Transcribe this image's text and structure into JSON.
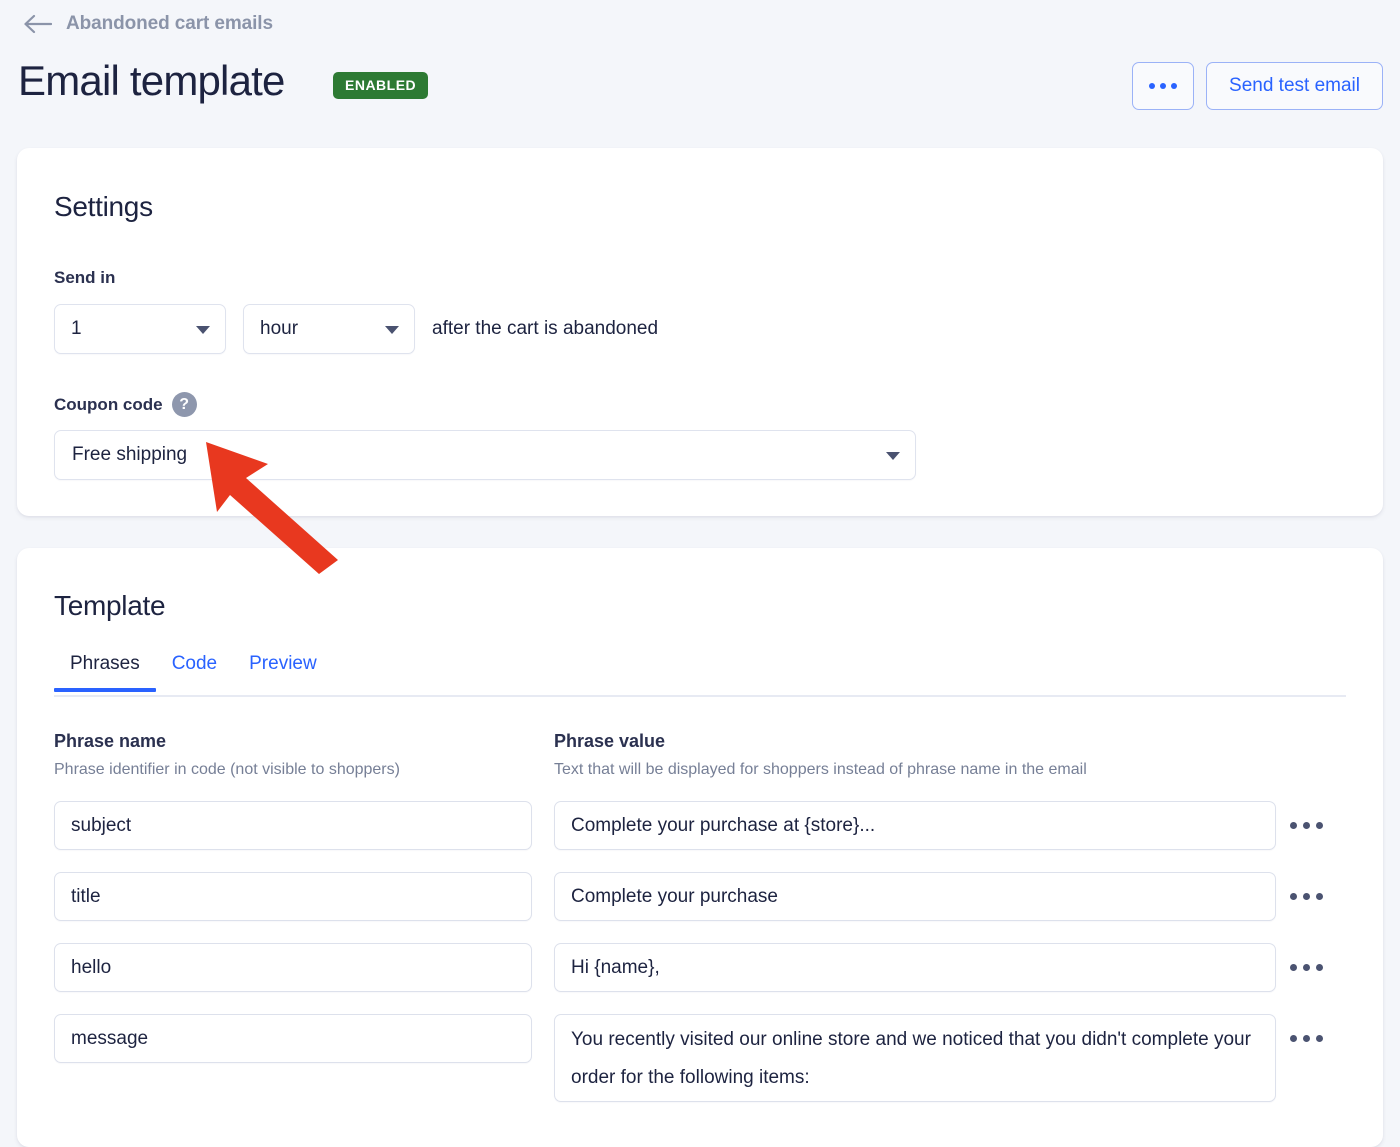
{
  "header": {
    "breadcrumb": "Abandoned cart emails",
    "back_icon": "arrow-left-icon",
    "title": "Email template",
    "status_badge": "ENABLED",
    "status_color": "#2d7a33",
    "overflow_button": "•••",
    "send_test_label": "Send test email",
    "accent_color": "#2962ff"
  },
  "settings": {
    "heading": "Settings",
    "send_in_label": "Send in",
    "amount_value": "1",
    "unit_value": "hour",
    "after_text": "after the cart is abandoned",
    "coupon_label": "Coupon code",
    "coupon_help_icon": "question-mark-icon",
    "coupon_value": "Free shipping"
  },
  "template": {
    "heading": "Template",
    "tabs": [
      {
        "label": "Phrases",
        "active": true
      },
      {
        "label": "Code",
        "active": false
      },
      {
        "label": "Preview",
        "active": false
      }
    ],
    "columns": {
      "name_title": "Phrase name",
      "name_sub": "Phrase identifier in code (not visible to shoppers)",
      "value_title": "Phrase value",
      "value_sub": "Text that will be displayed for shoppers instead of phrase name in the email"
    },
    "rows": [
      {
        "name": "subject",
        "value": "Complete your purchase at {store}..."
      },
      {
        "name": "title",
        "value": "Complete your purchase"
      },
      {
        "name": "hello",
        "value": "Hi {name},"
      },
      {
        "name": "message",
        "value": "You recently visited our online store and we noticed that you didn't complete your order for the following items:"
      }
    ]
  },
  "annotation": {
    "type": "arrow",
    "color": "#e8381f",
    "points_at": "coupon-code-select"
  }
}
